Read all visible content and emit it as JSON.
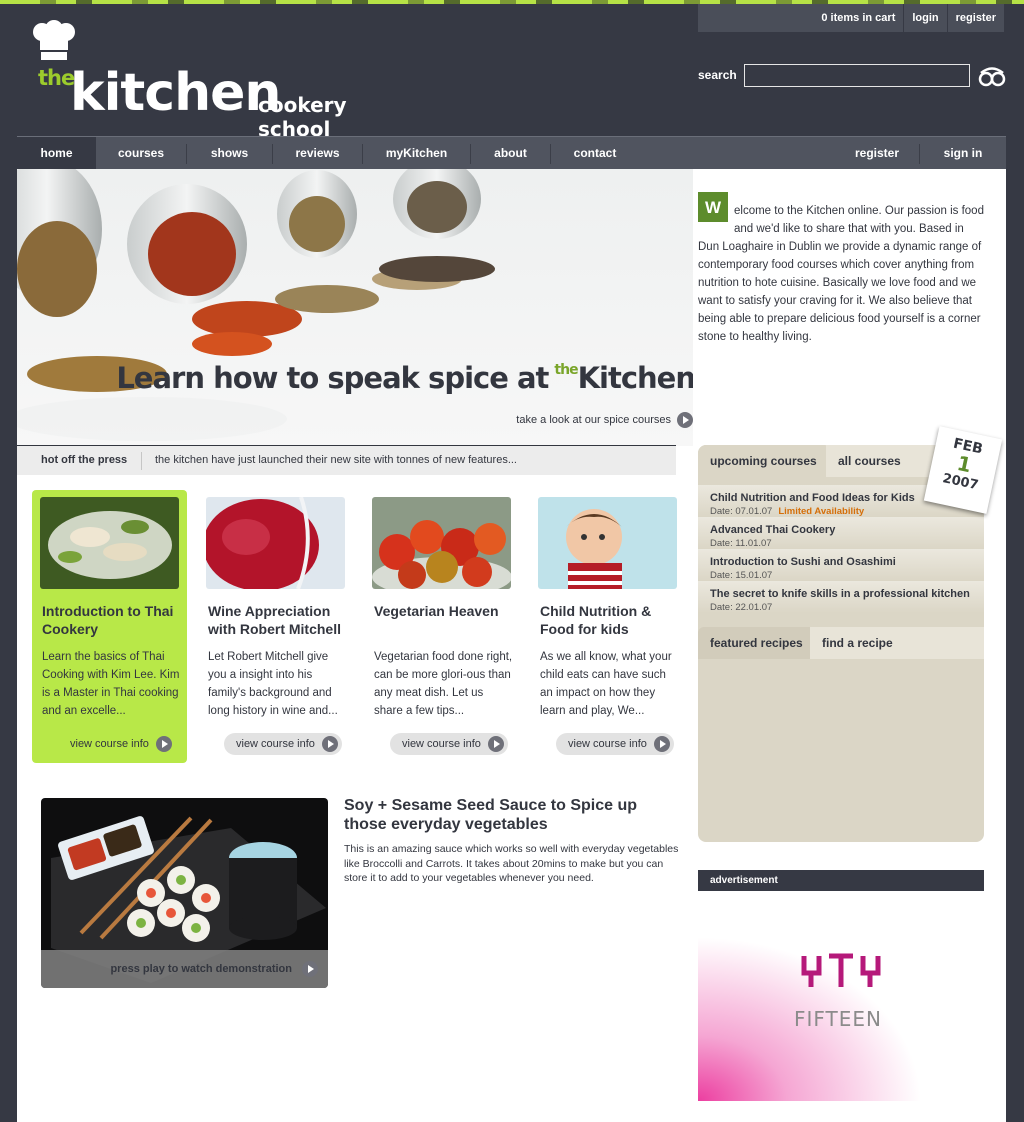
{
  "header": {
    "logo_the": "the",
    "logo_kitchen": "kitchen",
    "logo_sub": "cookery school",
    "cart": "0 items in cart",
    "login": "login",
    "register": "register",
    "search_label": "search",
    "search_value": ""
  },
  "nav": {
    "items": [
      "home",
      "courses",
      "shows",
      "reviews",
      "myKitchen",
      "about",
      "contact"
    ],
    "right": [
      "register",
      "sign in"
    ],
    "active": "home"
  },
  "hero": {
    "headline": "Learn how to speak spice at",
    "headline_the": "the",
    "headline_kitchen": "Kitchen",
    "link": "take a look at our spice courses"
  },
  "press": {
    "tag": "hot off the press",
    "text": "the kitchen have just launched their new site with tonnes of new features..."
  },
  "cards": [
    {
      "title": "Introduction to Thai Cookery",
      "text": "Learn the basics of Thai Cooking with Kim Lee. Kim is a Master in Thai cooking and an excelle...",
      "button": "view course info"
    },
    {
      "title": "Wine Appreciation with Robert Mitchell",
      "text": "Let Robert Mitchell give you a insight into his family's background and long history in wine and...",
      "button": "view course info"
    },
    {
      "title": "Vegetarian Heaven",
      "text": "Vegetarian food done right, can be more glori-ous than any meat dish. Let us share a few tips...",
      "button": "view course info"
    },
    {
      "title": "Child Nutrition & Food for kids",
      "text": "As we all know, what your child eats can have such an impact on how they learn and play, We...",
      "button": "view course info"
    }
  ],
  "recipe": {
    "title": "Soy + Sesame Seed Sauce to Spice up those everyday vegetables",
    "text": "This is an amazing sauce which works so well with everyday vegetables like Broccolli and Carrots. It takes about 20mins to make but you can store it to add to your vegetables whenever you need.",
    "video_label": "press play to watch demonstration"
  },
  "welcome": {
    "initial": "W",
    "first_line": "elcome to the Kitchen online. Our passion is",
    "rest": "food and we'd like to share that with you. Based in Dun Loaghaire in Dublin we provide a dynamic range of contemporary food courses which cover anything from nutrition to hote cuisine. Basically we love food and we want to satisfy your craving for it. We also believe that being able to prepare delicious food yourself is a corner stone to healthy living."
  },
  "calendar": {
    "month": "FEB",
    "day": "1",
    "year": "2007"
  },
  "sidebar": {
    "tab_upcoming": "upcoming courses",
    "tab_all": "all courses",
    "courses": [
      {
        "name": "Child Nutrition and Food Ideas for Kids",
        "date": "Date: 07.01.07",
        "note": "Limited Availability"
      },
      {
        "name": "Advanced Thai Cookery",
        "date": "Date: 11.01.07",
        "note": ""
      },
      {
        "name": "Introduction to Sushi and Osashimi",
        "date": "Date: 15.01.07",
        "note": ""
      },
      {
        "name": "The secret to knife skills in a professional kitchen",
        "date": "Date: 22.01.07",
        "note": ""
      }
    ],
    "tab_featured": "featured recipes",
    "tab_find": "find a recipe"
  },
  "advert": {
    "label": "advertisement",
    "brand": "FIFTEEN"
  },
  "colors": {
    "accent": "#b8e848",
    "dark": "#363944",
    "limited": "#d56f0a"
  }
}
